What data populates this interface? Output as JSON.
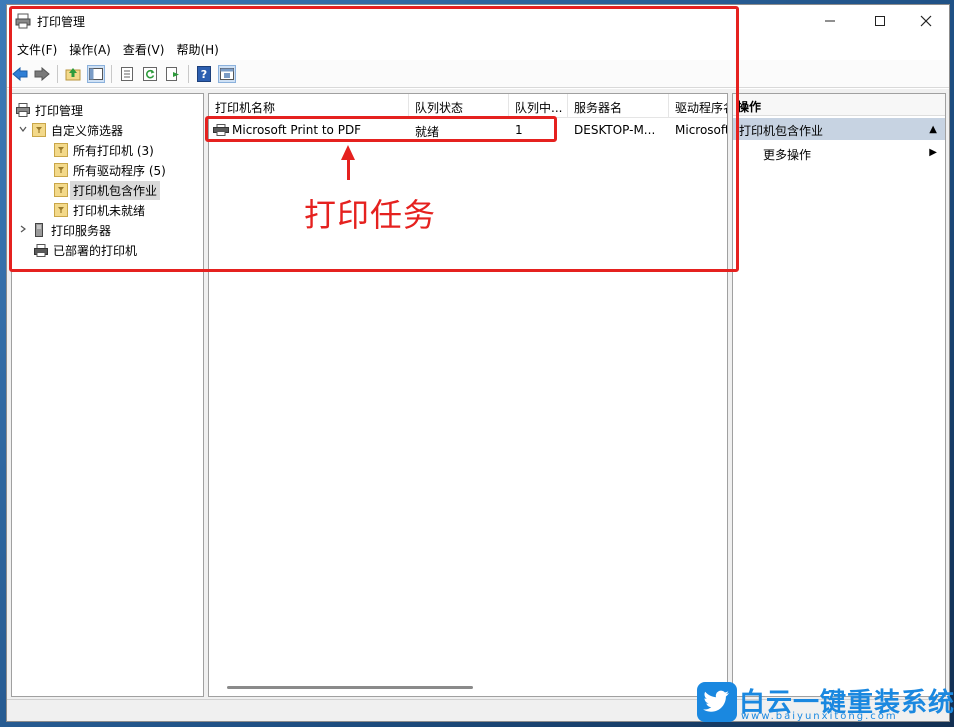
{
  "window": {
    "title": "打印管理"
  },
  "menu": [
    "文件(F)",
    "操作(A)",
    "查看(V)",
    "帮助(H)"
  ],
  "tree": {
    "root": "打印管理",
    "custom_filters": "自定义筛选器",
    "all_printers": "所有打印机 (3)",
    "all_drivers": "所有驱动程序 (5)",
    "printers_with_jobs": "打印机包含作业",
    "printers_not_ready": "打印机未就绪",
    "print_servers": "打印服务器",
    "deployed_printers": "已部署的打印机"
  },
  "list": {
    "columns": [
      "打印机名称",
      "队列状态",
      "队列中...",
      "服务器名",
      "驱动程序名"
    ],
    "rows": [
      [
        "Microsoft Print to PDF",
        "就绪",
        "1",
        "DESKTOP-M...",
        "Microsoft"
      ]
    ]
  },
  "actions": {
    "header": "操作",
    "section": "打印机包含作业",
    "more": "更多操作"
  },
  "annotation": {
    "label": "打印任务",
    "color": "#e5211f"
  },
  "watermark": {
    "title": "白云一键重装系统",
    "url": "www.baiyunxitong.com",
    "color": "#1a88e0"
  }
}
